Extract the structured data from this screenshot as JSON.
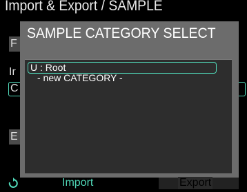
{
  "screen": {
    "title": "Import & Export / SAMPLE",
    "bg_label_f": "F",
    "bg_label_i": "Ir",
    "bg_label_c": "C",
    "bg_label_e": "E"
  },
  "modal": {
    "title": "SAMPLE CATEGORY SELECT",
    "items": [
      {
        "label": "U : Root",
        "selected": true
      },
      {
        "label": "- new CATEGORY -",
        "selected": false
      }
    ]
  },
  "bottom": {
    "refresh_icon": "refresh-icon",
    "import_label": "Import",
    "export_label": "Export"
  },
  "colors": {
    "accent": "#50d8b8",
    "modal_bg": "#6c6c6c",
    "list_bg": "#2d2d2d"
  }
}
